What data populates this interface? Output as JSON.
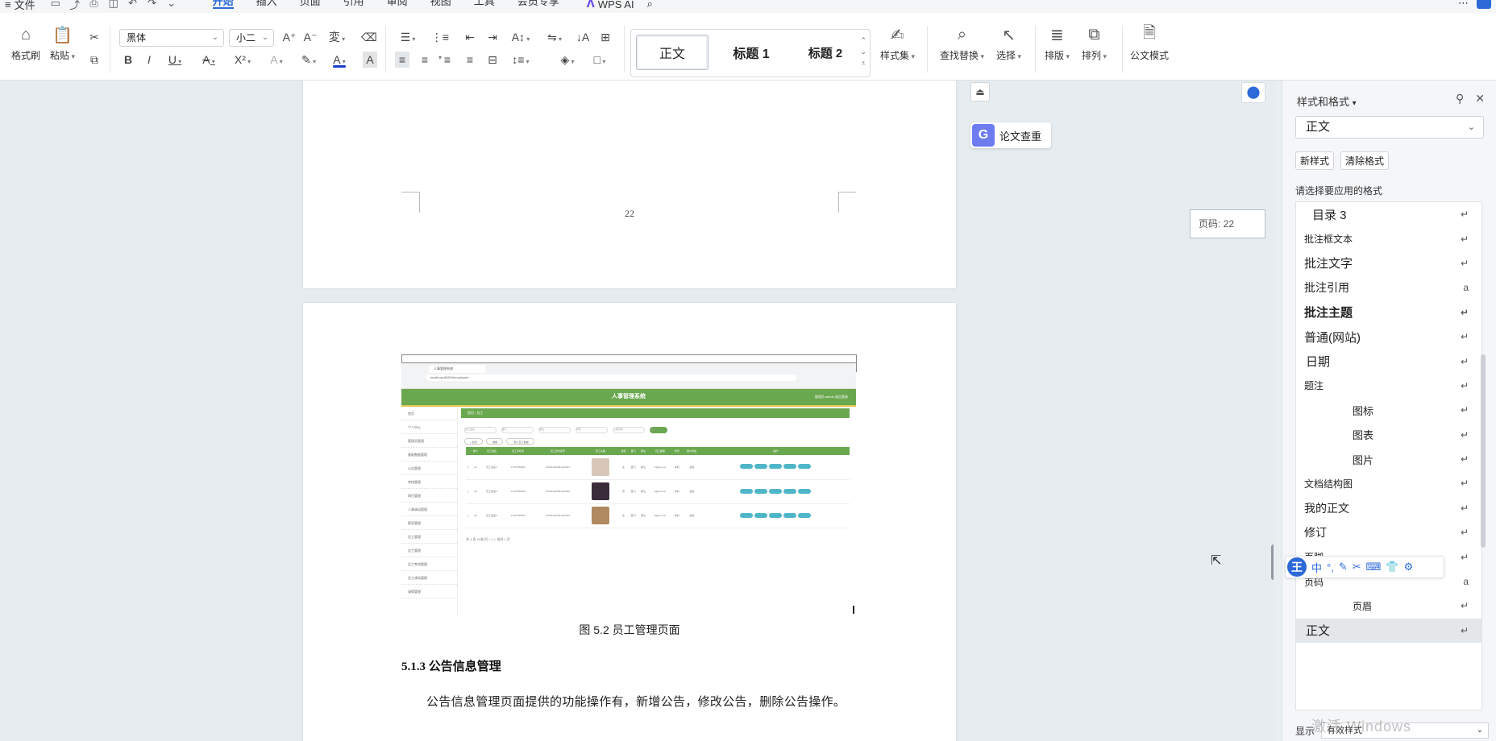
{
  "menubar": {
    "file_label": "文件",
    "tabs": [
      {
        "label": "开始",
        "active": true
      },
      {
        "label": "插入"
      },
      {
        "label": "页面"
      },
      {
        "label": "引用"
      },
      {
        "label": "审阅"
      },
      {
        "label": "视图"
      },
      {
        "label": "工具"
      },
      {
        "label": "会员专享"
      }
    ],
    "wps_ai_label": "WPS AI"
  },
  "ribbon": {
    "format_painter": "格式刷",
    "paste": "粘贴",
    "font_name": "黑体",
    "font_size": "小二",
    "styles": {
      "normal": "正文",
      "heading1": "标题 1",
      "heading2": "标题 2"
    },
    "style_set": "样式集",
    "find_replace": "查找替换",
    "select": "选择",
    "layout": "排版",
    "arrange": "排列",
    "official_doc_mode": "公文模式",
    "font_color": "#1c3fc9"
  },
  "document": {
    "page1_number": "22",
    "page_indicator": "页码: 22",
    "paper_check_label": "论文查重",
    "figure_caption": "图 5.2   员工管理页面",
    "heading": "5.1.3  公告信息管理",
    "body_text": "公告信息管理页面提供的功能操作有，新增公告，修改公告，删除公告操作。",
    "embedded_screenshot": {
      "app_title": "人事管理系统",
      "user_info": "管理员 admin   退出登录",
      "browser_tab": "人事管理系统",
      "url": "localhost:8080/#/employee",
      "breadcrumb": "首页  /  员工",
      "sidebar_items": [
        "首页",
        "个人中心",
        "管理员管理",
        "基础数据管理",
        "公告管理",
        "考核管理",
        "岗位管理",
        "人事调动管理",
        "薪资管理",
        "员工管理",
        "员工管理",
        "员工考核管理",
        "员工调动管理",
        "请假管理"
      ],
      "filters": [
        "员工姓名",
        "部门",
        "职位",
        "学历",
        "入职时间",
        "查询"
      ],
      "actions": [
        "+ 新增",
        "- 删除",
        "↑ 导入员工数据"
      ],
      "columns": [
        "",
        "账户",
        "员工姓名",
        "员工手机号",
        "员工身份证号",
        "员工头像",
        "性别",
        "部门",
        "职位",
        "员工邮箱",
        "学历",
        "账户状态",
        "操作"
      ],
      "rows": [
        {
          "account": "a1",
          "name": "员工姓名1",
          "phone": "17703786901",
          "idcard": "410224199901010001",
          "gender": "女",
          "dept": "部门",
          "pos": "职位",
          "mail": "1@qq.com",
          "edu": "本科",
          "status": "启用",
          "avatar_color": "#d8c7b8"
        },
        {
          "account": "a2",
          "name": "员工姓名2",
          "phone": "17703786902",
          "idcard": "410224199901010002",
          "gender": "男",
          "dept": "部门",
          "pos": "职位",
          "mail": "2@qq.com",
          "edu": "本科",
          "status": "启用",
          "avatar_color": "#3a2b3a"
        },
        {
          "account": "a3",
          "name": "员工姓名3",
          "phone": "17703786903",
          "idcard": "410224199901010003",
          "gender": "女",
          "dept": "部门",
          "pos": "职位",
          "mail": "3@qq.com",
          "edu": "本科",
          "status": "启用",
          "avatar_color": "#b08a60"
        }
      ],
      "pager": "共 3 条   10条/页   <   1   >   前往   1   页"
    }
  },
  "pane": {
    "title": "样式和格式",
    "current_style": "正文",
    "new_style": "新样式",
    "clear_format": "清除格式",
    "hint": "请选择要应用的格式",
    "items": [
      {
        "label": "目录 3",
        "indent": 10,
        "size": 15,
        "bold": false,
        "mark": "↵"
      },
      {
        "label": "批注框文本",
        "indent": 0,
        "size": 12,
        "bold": false,
        "mark": "↵"
      },
      {
        "label": "批注文字",
        "indent": 0,
        "size": 15,
        "bold": false,
        "mark": "↵"
      },
      {
        "label": "批注引用",
        "indent": 0,
        "size": 14,
        "bold": false,
        "mark": "a"
      },
      {
        "label": "批注主题",
        "indent": 0,
        "size": 15,
        "bold": true,
        "mark": "↵"
      },
      {
        "label": "普通(网站)",
        "indent": 0,
        "size": 15,
        "bold": false,
        "mark": "↵"
      },
      {
        "label": "日期",
        "indent": 2,
        "size": 15,
        "bold": false,
        "mark": "↵"
      },
      {
        "label": "题注",
        "indent": 0,
        "size": 12,
        "bold": false,
        "mark": "↵"
      },
      {
        "label": "图标",
        "indent": 60,
        "size": 13,
        "bold": false,
        "mark": "↵"
      },
      {
        "label": "图表",
        "indent": 60,
        "size": 13,
        "bold": false,
        "mark": "↵"
      },
      {
        "label": "图片",
        "indent": 60,
        "size": 13,
        "bold": false,
        "mark": "↵"
      },
      {
        "label": "文档结构图",
        "indent": 0,
        "size": 12,
        "bold": false,
        "mark": "↵"
      },
      {
        "label": "我的正文",
        "indent": 0,
        "size": 14,
        "bold": false,
        "mark": "↵"
      },
      {
        "label": "修订",
        "indent": 0,
        "size": 14,
        "bold": false,
        "mark": "↵"
      },
      {
        "label": "页脚",
        "indent": 0,
        "size": 12,
        "bold": false,
        "mark": "↵"
      },
      {
        "label": "页码",
        "indent": 0,
        "size": 12,
        "bold": false,
        "mark": "a"
      },
      {
        "label": "页眉",
        "indent": 60,
        "size": 12,
        "bold": false,
        "mark": "↵"
      },
      {
        "label": "正文",
        "indent": 2,
        "size": 15,
        "bold": false,
        "mark": "↵",
        "selected": true
      }
    ],
    "show_label": "显示",
    "show_value": "有效样式",
    "watermark": "激活 Windows"
  },
  "ime": {
    "logo": "王",
    "mode": "中"
  }
}
